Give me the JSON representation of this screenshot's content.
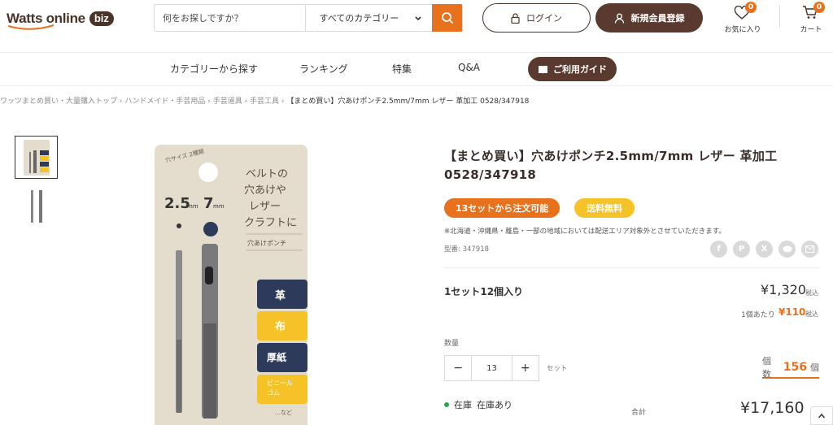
{
  "header": {
    "logo": {
      "text": "Watts online",
      "biz": "biz"
    },
    "search": {
      "placeholder": "何をお探しですか？",
      "category": "すべてのカテゴリー"
    },
    "login_label": "ログイン",
    "signup_label": "新規会員登録",
    "favorites": {
      "label": "お気に入り",
      "count": "0"
    },
    "cart": {
      "label": "カート",
      "count": "0"
    }
  },
  "nav": {
    "items": [
      "カテゴリーから探す",
      "ランキング",
      "特集",
      "Q&A"
    ],
    "guide_label": "ご利用ガイド"
  },
  "breadcrumb": {
    "items": [
      "ワッツまとめ買い・大量購入トップ",
      "ハンドメイド・手芸用品",
      "手芸道具",
      "手芸工具"
    ],
    "current": "【まとめ買い】穴あけポンチ2.5mm/7mm レザー 革加工 0528/347918"
  },
  "product": {
    "title": "【まとめ買い】穴あけポンチ2.5mm/7mm レザー 革加工 0528/347918",
    "tag_order": "13セットから注文可能",
    "tag_shipping": "送料無料",
    "shipping_note": "※北海道・沖縄県・離島・一部の地域においては配送エリア対象外とさせていただきます。",
    "model": "型番: 347918",
    "set_label": "1セット12個入り",
    "price": "¥1,320",
    "tax_label": "税込",
    "unit_label": "1個あたり",
    "unit_price": "¥110",
    "qty_label": "数量",
    "quantity": "13",
    "minus": "−",
    "plus": "+",
    "set_unit": "セット",
    "count_prefix": "個数",
    "count": "156",
    "count_suffix": "個",
    "stock_label": "在庫",
    "stock_status": "在庫あり",
    "total_label": "合計",
    "total": "¥17,160"
  },
  "package": {
    "size_note": "穴サイズ\n2種類",
    "size_a": "2.5",
    "size_b": "7",
    "unit": "mm",
    "copy": "ベルトの\n穴あけや\nレザー\nクラフトに",
    "product_name": "穴あけポンチ",
    "materials": [
      "革",
      "布",
      "厚紙",
      "ビニール\nゴム"
    ],
    "more": "…など"
  },
  "share_icons": [
    "facebook-icon",
    "pinterest-icon",
    "x-icon",
    "line-icon",
    "mail-icon"
  ],
  "colors": {
    "accent": "#e8711d",
    "brand": "#5a3a2e",
    "yellow": "#f5c228",
    "navy": "#2e3a5c"
  }
}
